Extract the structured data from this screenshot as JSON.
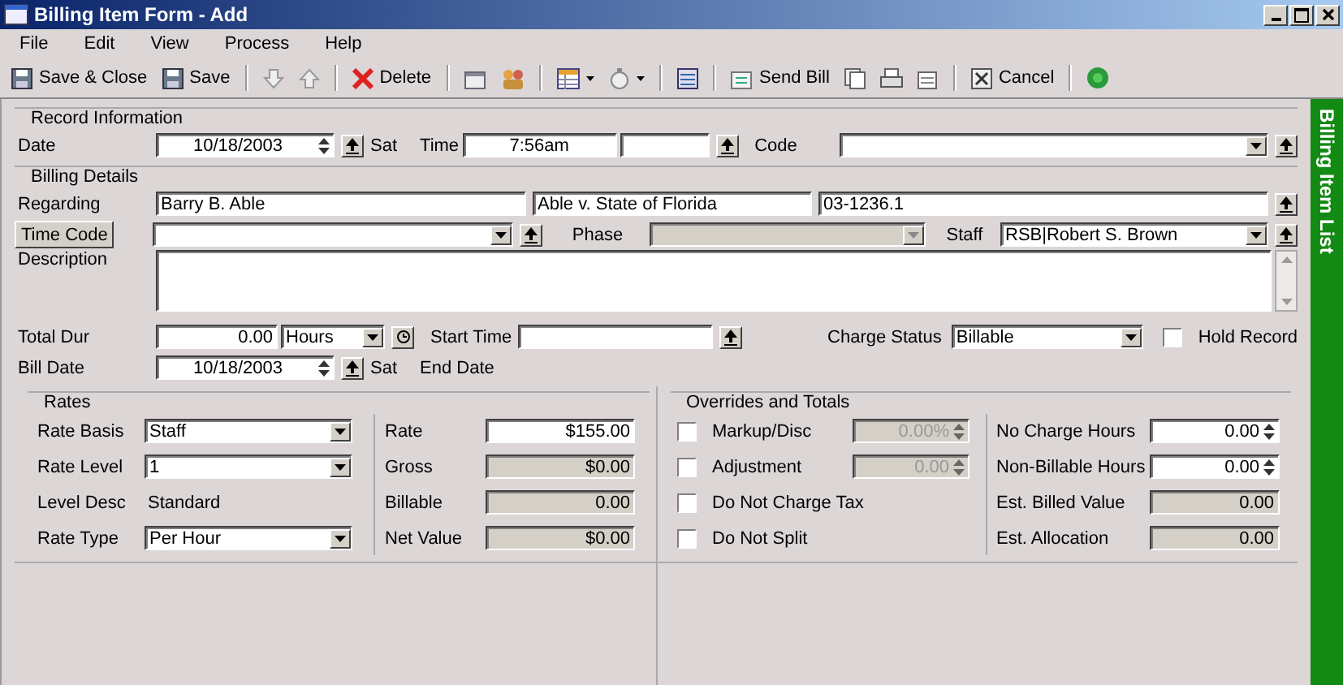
{
  "window": {
    "title": "Billing Item Form - Add"
  },
  "menu": [
    "File",
    "Edit",
    "View",
    "Process",
    "Help"
  ],
  "toolbar": {
    "save_close": "Save & Close",
    "save": "Save",
    "delete": "Delete",
    "send_bill": "Send Bill",
    "cancel": "Cancel"
  },
  "record_information": {
    "legend": "Record Information",
    "date_label": "Date",
    "date": "10/18/2003",
    "date_day": "Sat",
    "time_label": "Time",
    "time": "7:56am",
    "code_label": "Code"
  },
  "billing_details": {
    "legend": "Billing Details",
    "regarding_label": "Regarding",
    "client": "Barry B. Able",
    "matter": "Able v. State of Florida",
    "matter_number": "03-1236.1",
    "time_code_button": "Time Code",
    "phase_label": "Phase",
    "staff_label": "Staff",
    "staff": "RSB|Robert S. Brown",
    "description_label": "Description",
    "total_dur_label": "Total Dur",
    "total_dur": "0.00",
    "dur_unit": "Hours",
    "start_time_label": "Start Time",
    "charge_status_label": "Charge Status",
    "charge_status": "Billable",
    "hold_record": {
      "label": "Hold Record",
      "checked": false
    },
    "bill_date_label": "Bill Date",
    "bill_date": "10/18/2003",
    "bill_date_day": "Sat",
    "end_date_label": "End Date"
  },
  "rates": {
    "legend": "Rates",
    "left": [
      {
        "label": "Rate Basis",
        "value": "Staff",
        "kind": "dropdown"
      },
      {
        "label": "Rate Level",
        "value": "1",
        "kind": "dropdown"
      },
      {
        "label": "Level Desc",
        "value": "Standard",
        "kind": "text"
      },
      {
        "label": "Rate Type",
        "value": "Per Hour",
        "kind": "dropdown"
      }
    ],
    "right": [
      {
        "label": "Rate",
        "value": "$155.00",
        "disabled": false
      },
      {
        "label": "Gross",
        "value": "$0.00",
        "disabled": true
      },
      {
        "label": "Billable",
        "value": "0.00",
        "disabled": true
      },
      {
        "label": "Net Value",
        "value": "$0.00",
        "disabled": true
      }
    ]
  },
  "overrides": {
    "legend": "Overrides and Totals",
    "options": [
      {
        "label": "Markup/Disc",
        "checked": false,
        "value": "0.00%"
      },
      {
        "label": "Adjustment",
        "checked": false,
        "value": "0.00"
      },
      {
        "label": "Do Not Charge Tax",
        "checked": false
      },
      {
        "label": "Do Not Split",
        "checked": false
      }
    ],
    "totals": [
      {
        "label": "No Charge Hours",
        "value": "0.00",
        "kind": "spin"
      },
      {
        "label": "Non-Billable Hours",
        "value": "0.00",
        "kind": "spin"
      },
      {
        "label": "Est. Billed Value",
        "value": "0.00",
        "kind": "readonly"
      },
      {
        "label": "Est. Allocation",
        "value": "0.00",
        "kind": "readonly"
      }
    ]
  },
  "side_panel": {
    "title": "Billing Item List"
  }
}
